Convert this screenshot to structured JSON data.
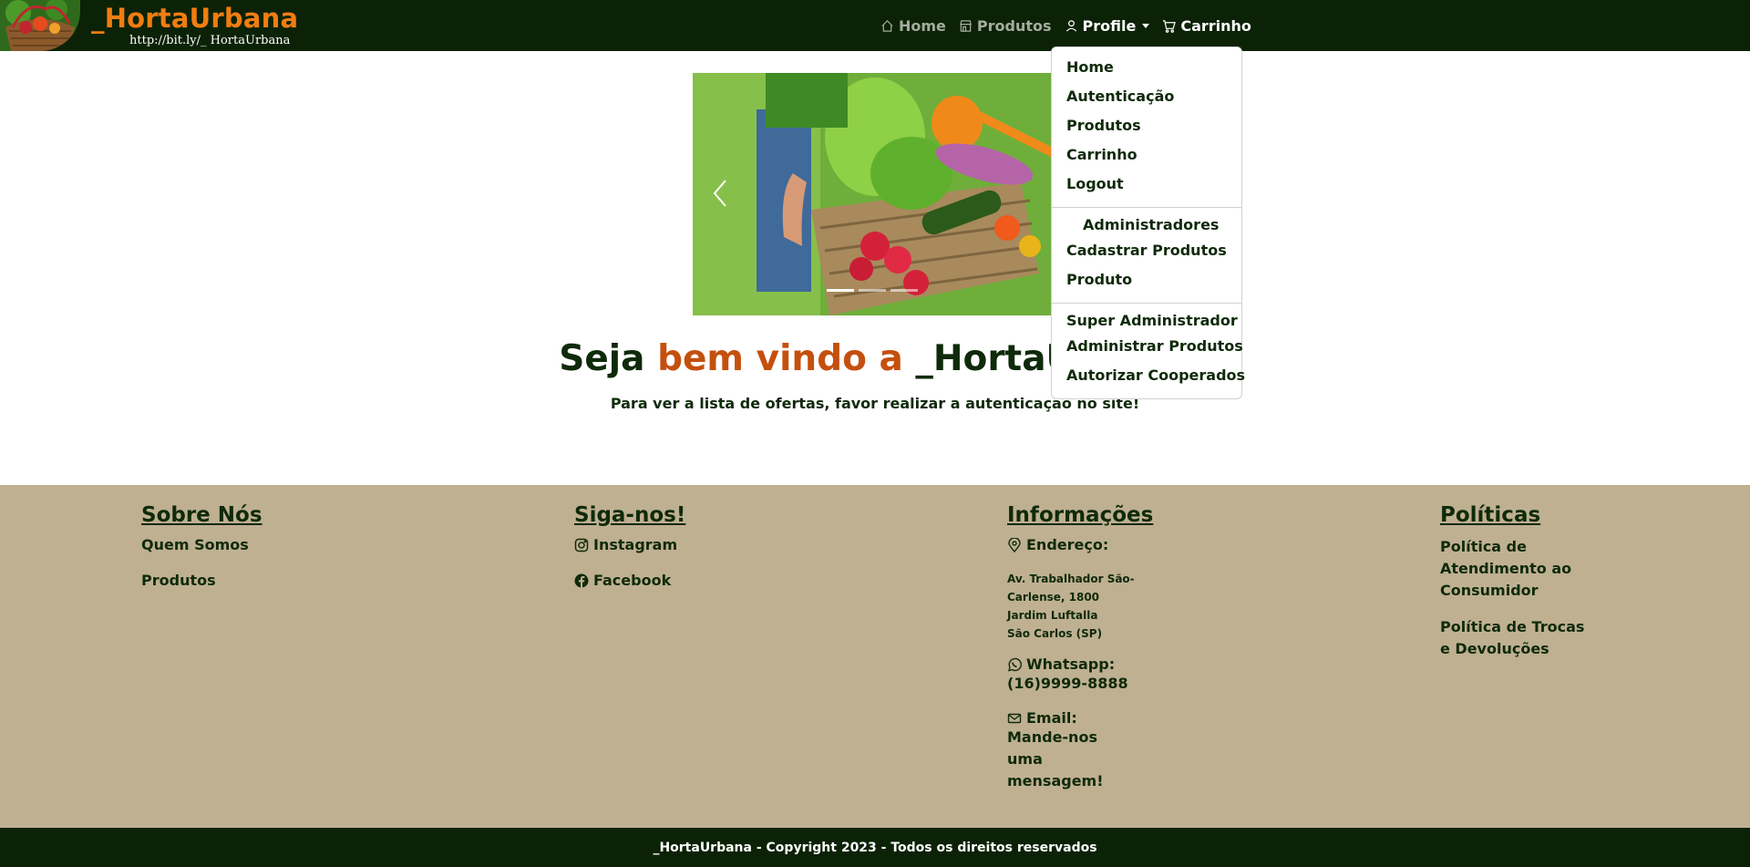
{
  "navbar": {
    "logo_icon": "vegetable-basket-logo",
    "brand": "_HortaUrbana",
    "brand_url": "http://bit.ly/_ HortaUrbana",
    "links": {
      "home": "Home",
      "produtos": "Produtos",
      "profile": "Profile",
      "carrinho": "Carrinho"
    },
    "icons": {
      "home": "house-icon",
      "produtos": "shop-icon",
      "profile": "person-icon",
      "carrinho": "cart-icon"
    }
  },
  "dropdown": {
    "items": [
      "Home",
      "Autenticação",
      "Produtos",
      "Carrinho",
      "Logout"
    ],
    "admin_header": "Administradores",
    "admin_items": [
      "Cadastrar Produtos",
      "Produto"
    ],
    "super_header": "Super Administrador",
    "super_items": [
      "Administrar Produtos",
      "Autorizar Cooperados"
    ]
  },
  "carousel": {
    "image": "vegetable-basket-photo",
    "slides_count": 3,
    "active_slide": 1
  },
  "hero": {
    "title_part1": "Seja ",
    "title_accent": "bem vindo a ",
    "title_part2": "_HortaUrbana",
    "subtitle": "Para ver a lista de ofertas, favor realizar a autenticação no site!"
  },
  "footer": {
    "sobre": {
      "title": "Sobre Nós",
      "links": [
        "Quem Somos",
        "Produtos"
      ]
    },
    "siga": {
      "title": "Siga-nos!",
      "instagram": "Instagram",
      "facebook": "Facebook"
    },
    "info": {
      "title": "Informações",
      "endereco_label": "Endereço:",
      "address_lines": [
        "Av. Trabalhador São-",
        "Carlense, 1800",
        "Jardim Luftalla",
        "São Carlos (SP)"
      ],
      "whatsapp_label": "Whatsapp:",
      "whatsapp_value": "(16)9999-8888",
      "email_label": "Email:",
      "email_value": "Mande-nos uma mensagem!"
    },
    "politicas": {
      "title": "Políticas",
      "links": [
        "Política de Atendimento ao Consumidor",
        "Política de Trocas e Devoluções"
      ]
    }
  },
  "copyright": "_HortaUrbana - Copyright 2023 - Todos os direitos reservados",
  "colors": {
    "dark_green": "#0c2206",
    "brand_orange": "#f07d12",
    "accent_orange": "#c4500e",
    "footer_tan": "#bfb092"
  }
}
